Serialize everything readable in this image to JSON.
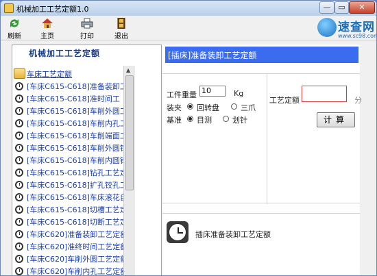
{
  "window": {
    "title": "机械加工工艺定额1.0",
    "min_label": "—",
    "max_label": "▭",
    "close_label": "✕"
  },
  "toolbar": {
    "refresh": "刷新",
    "home": "主页",
    "print": "打印",
    "exit": "退出"
  },
  "brand": {
    "name": "速查网",
    "url": "www.sc98.com"
  },
  "sidebar": {
    "title": "机械加工工艺定额",
    "root": "车床工艺定额",
    "items": [
      "[车床C615-C618]准备装卸工",
      "[车床C615-C618]准时间工",
      "[车床C615-C618]车削外圆工",
      "[车床C615-C618]车削内孔工",
      "[车床C615-C618]车削端面工",
      "[车床C615-C618]车削外圆锥",
      "[车床C615-C618]车削内圆锥",
      "[车床C615-C618]钻孔工艺定",
      "[车床C615-C618]扩孔铰孔工",
      "[车床C615-C618]车床滚花自",
      "[车床C615-C618]切槽工艺定",
      "[车床C615-C618]切断工艺定",
      "[车床C620]准备装卸工艺定额",
      "[车床C620]准终时间工艺定额",
      "[车床C620]车削外圆工艺定额",
      "[车床C620]车削内孔工艺定额"
    ]
  },
  "panel": {
    "header": "[插床]准备装卸工艺定额",
    "weight_label": "工件重量",
    "weight_value": "10",
    "weight_unit": "Kg",
    "clamp_label": "装夹",
    "clamp_opt1": "回转盘",
    "clamp_opt2": "三爪",
    "datum_label": "基准",
    "datum_opt1": "目测",
    "datum_opt2": "划针",
    "quota_label": "工艺定额",
    "quota_value": "",
    "quota_unit": "分",
    "calc_button": "计算",
    "info_text": "插床准备装卸工艺定额"
  }
}
